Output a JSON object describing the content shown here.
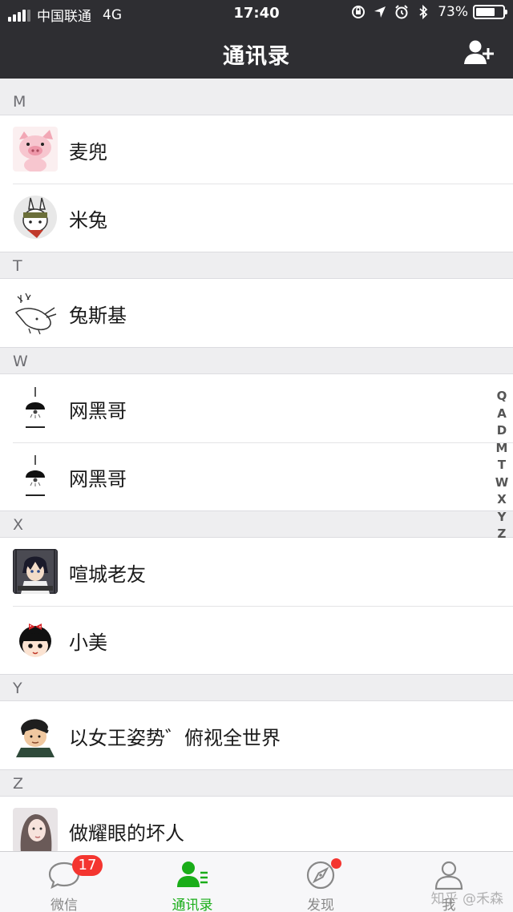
{
  "status_bar": {
    "carrier": "中国联通",
    "network": "4G",
    "time": "17:40",
    "battery": "73%",
    "battery_level": 0.73
  },
  "header": {
    "title": "通讯录",
    "add_icon": "add-friend-icon"
  },
  "sections": [
    {
      "letter": "M",
      "contacts": [
        {
          "name": "麦兜"
        },
        {
          "name": "米兔"
        }
      ]
    },
    {
      "letter": "T",
      "contacts": [
        {
          "name": "兔斯基"
        }
      ]
    },
    {
      "letter": "W",
      "contacts": [
        {
          "name": "网黑哥"
        },
        {
          "name": "网黑哥"
        }
      ]
    },
    {
      "letter": "X",
      "contacts": [
        {
          "name": "喧城老友"
        },
        {
          "name": "小美"
        }
      ]
    },
    {
      "letter": "Y",
      "contacts": [
        {
          "name": "以女王姿势゛俯视全世界"
        }
      ]
    },
    {
      "letter": "Z",
      "contacts": [
        {
          "name": "做耀眼的坏人"
        }
      ]
    }
  ],
  "index_bar": [
    "Q",
    "A",
    "D",
    "M",
    "T",
    "W",
    "X",
    "Y",
    "Z"
  ],
  "tabs": [
    {
      "label": "微信",
      "badge": "17",
      "icon": "chat-icon"
    },
    {
      "label": "通讯录",
      "icon": "contacts-icon",
      "active": true
    },
    {
      "label": "发现",
      "icon": "compass-icon",
      "dot": true
    },
    {
      "label": "我",
      "icon": "person-icon"
    }
  ],
  "watermark": "知乎 @禾森",
  "colors": {
    "bar": "#2e2e32",
    "accent": "#1aad19",
    "badge": "#f43530",
    "section_bg": "#eeeef0"
  }
}
